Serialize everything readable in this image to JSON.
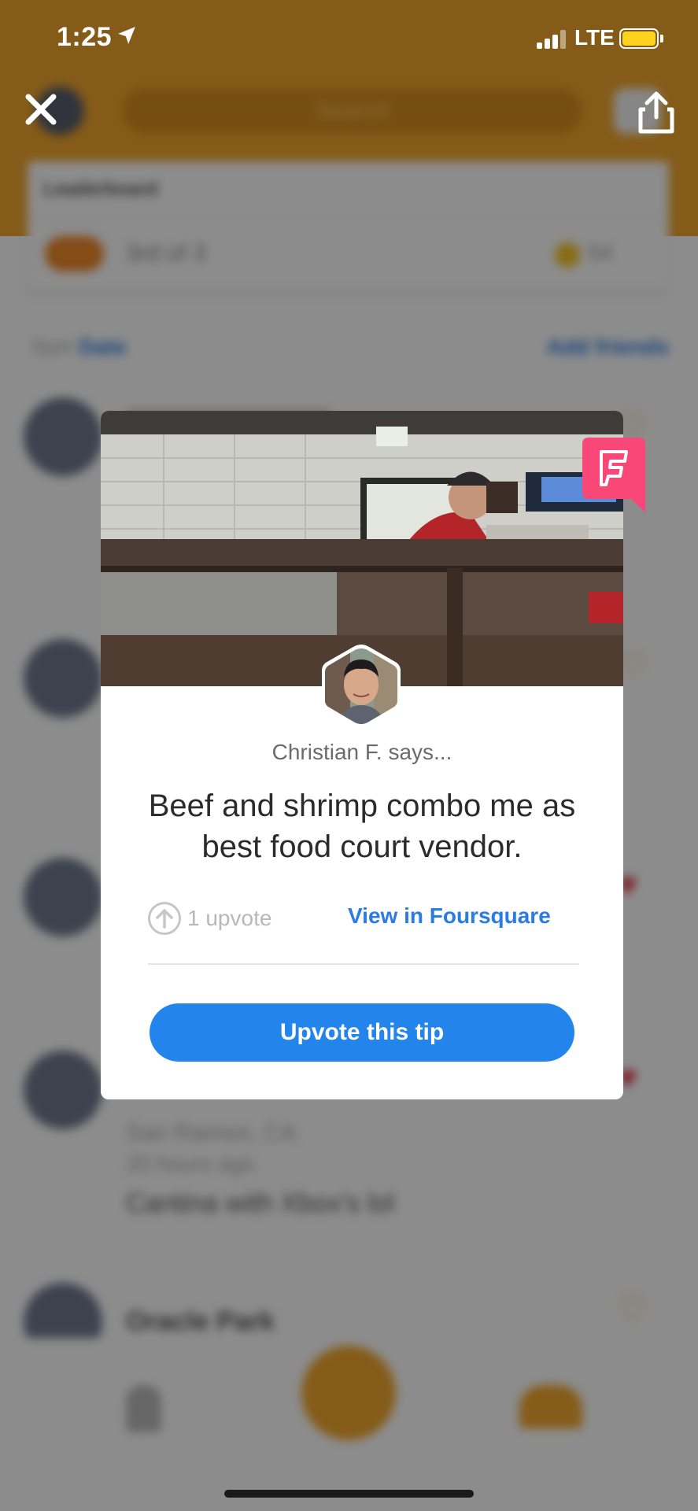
{
  "status_bar": {
    "time": "1:25",
    "network": "LTE",
    "battery_color": "#ffd21f"
  },
  "background": {
    "search_placeholder": "Search",
    "leaderboard_title": "Leaderboard",
    "leaderboard_rank": "3rd of 3",
    "leaderboard_coins": "54",
    "sort_label": "Sort",
    "sort_value": "Date",
    "add_friends": "Add friends",
    "feed_snippet_location": "San Ramon, CA",
    "feed_snippet_time": "20 hours ago",
    "feed_snippet_text": "Cantina with Xbox's lol",
    "feed_snippet_venue": "Oracle Park",
    "accent_color": "#f2a72e"
  },
  "tip": {
    "author": "Christian F. says...",
    "text": "Beef and shrimp combo me as best food court vendor.",
    "upvotes": "1 upvote",
    "view_link": "View in Foursquare",
    "upvote_button": "Upvote this tip",
    "brand_color": "#f94877",
    "button_color": "#2385ec"
  },
  "overlay_icons": {
    "close": "close-icon",
    "share": "share-icon",
    "foursquare": "foursquare-logo-icon",
    "upvote": "arrow-up-icon"
  }
}
